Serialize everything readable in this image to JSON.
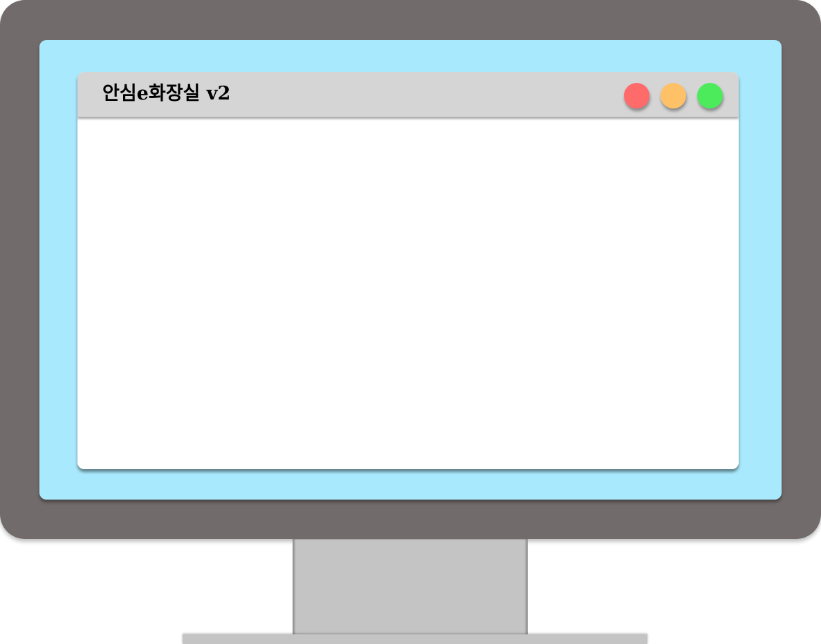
{
  "window": {
    "title": "안심e화장실 v2"
  },
  "controls": {
    "close_icon": "close-dot",
    "minimize_icon": "minimize-dot",
    "maximize_icon": "maximize-dot"
  },
  "colors": {
    "monitor_frame": "#726b6b",
    "screen_background": "#a9e9fd",
    "titlebar": "#d5d5d5",
    "window_body": "#ffffff",
    "close": "#ff6a6a",
    "minimize": "#ffc168",
    "maximize": "#4ceb5c",
    "stand": "#c4c4c4"
  }
}
